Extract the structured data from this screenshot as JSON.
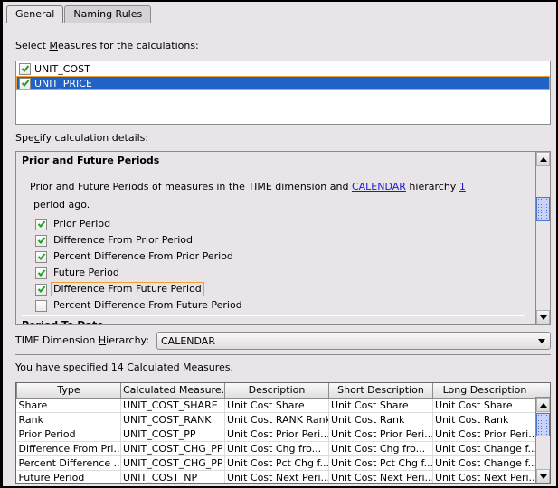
{
  "tabs": [
    {
      "label": "General",
      "active": true
    },
    {
      "label": "Naming Rules",
      "active": false
    }
  ],
  "measures": {
    "label_pre": "Select ",
    "label_mnemonic": "M",
    "label_post": "easures for the calculations:",
    "items": [
      {
        "label": "UNIT_COST",
        "checked": true,
        "selected": false
      },
      {
        "label": "UNIT_PRICE",
        "checked": true,
        "selected": true
      }
    ]
  },
  "details": {
    "label_pre": "Spe",
    "label_mnemonic": "c",
    "label_post": "ify calculation details:",
    "section_title": "Prior and Future Periods",
    "next_section_title": "Period To Date",
    "desc_part1": "Prior and Future Periods of measures in the ",
    "dimension": "TIME",
    "desc_part2": " dimension and ",
    "hierarchy_link": "CALENDAR",
    "desc_part3": " hierarchy ",
    "periods_link": "1",
    "desc_line2": "period ago.",
    "options": [
      {
        "label": "Prior Period",
        "checked": true,
        "focused": false
      },
      {
        "label": "Difference From Prior Period",
        "checked": true,
        "focused": false
      },
      {
        "label": "Percent Difference From Prior Period",
        "checked": true,
        "focused": false
      },
      {
        "label": "Future Period",
        "checked": true,
        "focused": false
      },
      {
        "label": "Difference From Future Period",
        "checked": true,
        "focused": true
      },
      {
        "label": "Percent Difference From Future Period",
        "checked": false,
        "focused": false
      }
    ]
  },
  "hierarchy": {
    "label_pre": "TIME Dimension ",
    "label_mnemonic": "H",
    "label_post": "ierarchy:",
    "selected": "CALENDAR"
  },
  "summary": "You have specified 14 Calculated Measures.",
  "table": {
    "columns": [
      "Type",
      "Calculated Measure...",
      "Description",
      "Short Description",
      "Long Description"
    ],
    "rows": [
      [
        "Share",
        "UNIT_COST_SHARE",
        "Unit Cost Share",
        "Unit Cost Share",
        "Unit Cost Share"
      ],
      [
        "Rank",
        "UNIT_COST_RANK",
        "Unit Cost RANK Rank",
        "Unit Cost Rank",
        "Unit Cost Rank"
      ],
      [
        "Prior Period",
        "UNIT_COST_PP",
        "Unit Cost Prior Peri...",
        "Unit Cost Prior Peri...",
        "Unit Cost Prior Peri..."
      ],
      [
        "Difference From Pri...",
        "UNIT_COST_CHG_PP",
        "Unit Cost Chg fro...",
        "Unit Cost Chg fro...",
        "Unit Cost Change f..."
      ],
      [
        "Percent Difference ...",
        "UNIT_COST_CHG_PP",
        "Unit Cost Pct Chg f...",
        "Unit Cost Pct Chg f...",
        "Unit Cost Change f..."
      ],
      [
        "Future Period",
        "UNIT_COST_NP",
        "Unit Cost Next Peri...",
        "Unit Cost Next Peri...",
        "Unit Cost Next Peri..."
      ]
    ]
  },
  "icons": {
    "check": "checkmark-icon",
    "scroll_up": "arrow-up-icon",
    "scroll_down": "arrow-down-icon",
    "combo_arrow": "chevron-down-icon"
  },
  "colors": {
    "selection": "#2162c6",
    "focus": "#f0a030",
    "link": "#1a1ad0",
    "check": "#1fa21f",
    "background": "#e8e4e8"
  }
}
